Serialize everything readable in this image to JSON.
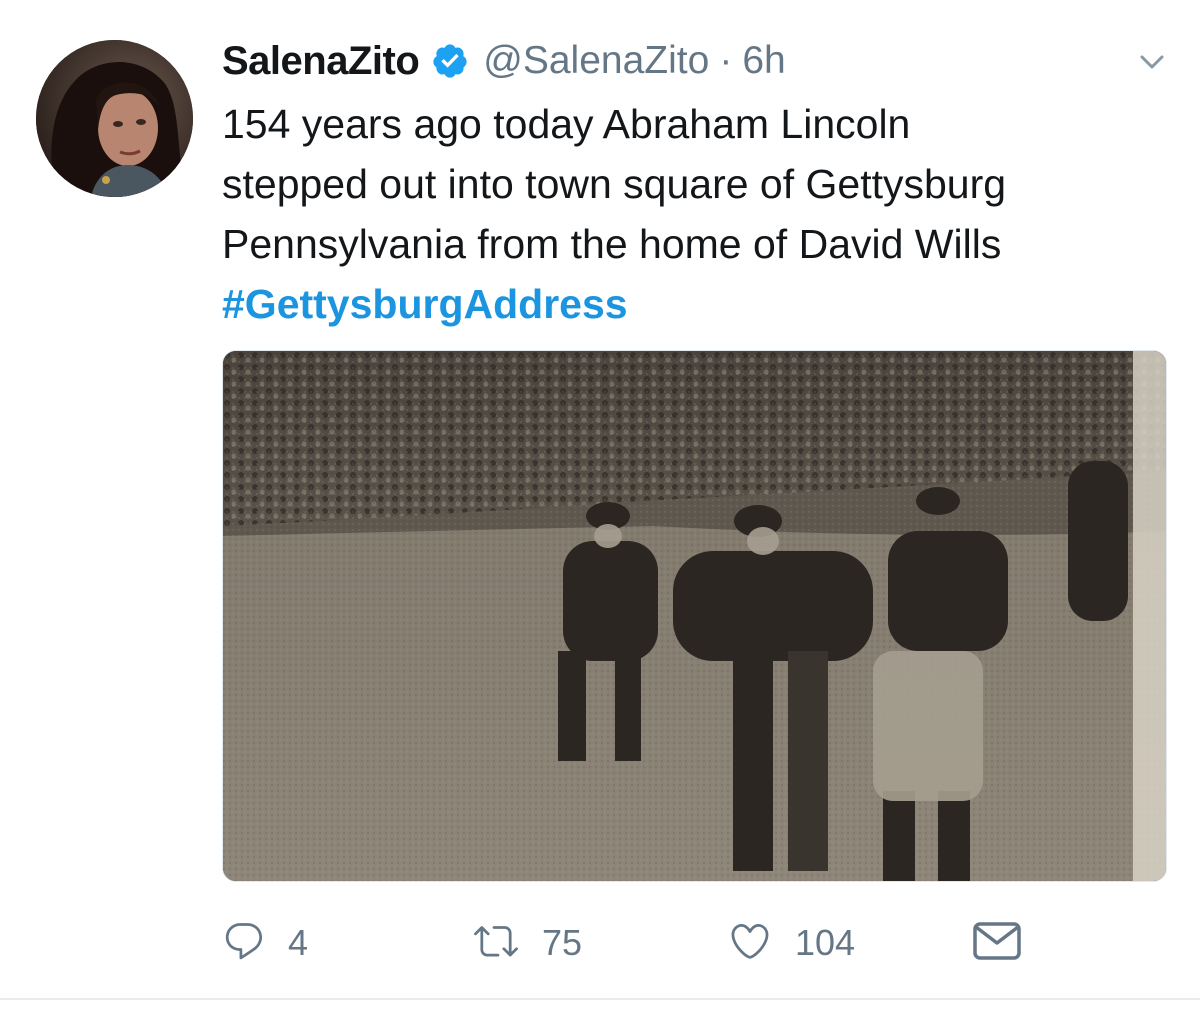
{
  "tweet": {
    "author_name": "SalenaZito",
    "handle": "@SalenaZito",
    "separator": "·",
    "time": "6h",
    "text_lines": [
      "154 years ago today Abraham Lincoln",
      "stepped out into town square of Gettysburg",
      "Pennsylvania from the home of David Wills"
    ],
    "hashtag": "#GettysburgAddress",
    "stats": {
      "replies": "4",
      "retweets": "75",
      "likes": "104"
    }
  },
  "colors": {
    "link": "#1b95e0",
    "muted": "#657786",
    "verified": "#1da1f2",
    "divider": "#e6ecf0"
  },
  "icons": {
    "verified": "verified-badge-icon",
    "more": "chevron-down-icon",
    "reply": "reply-bubble-icon",
    "retweet": "retweet-icon",
    "like": "heart-icon",
    "message": "envelope-icon"
  }
}
